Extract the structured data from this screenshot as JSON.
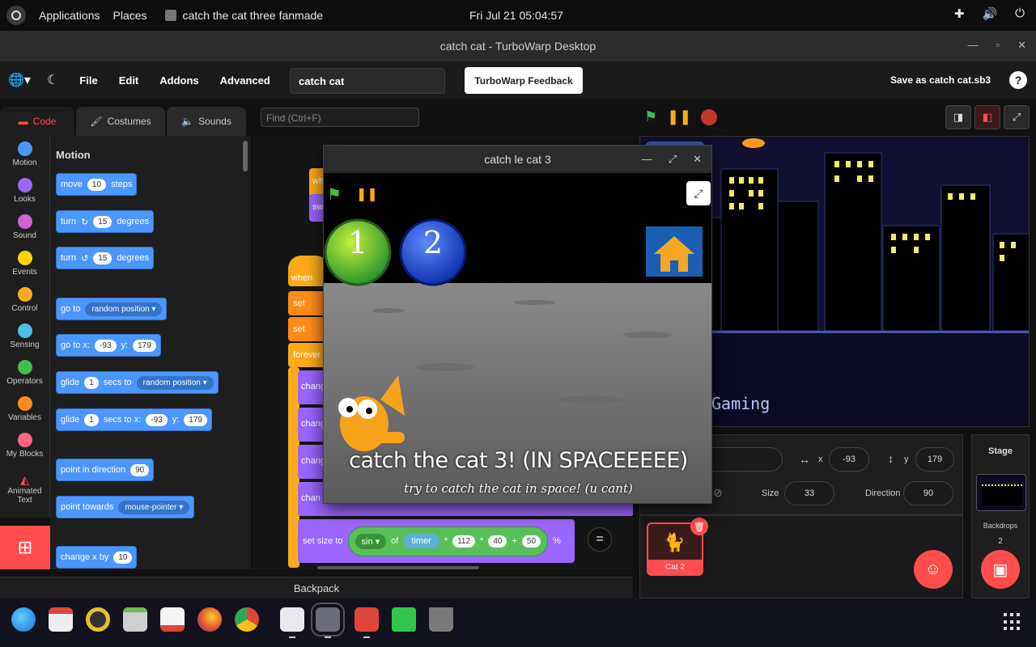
{
  "topbar": {
    "applications": "Applications",
    "places": "Places",
    "app_name": "catch the cat three fanmade",
    "clock": "Fri Jul 21  05:04:57",
    "tray_icons": [
      "puzzle-icon",
      "volume-icon",
      "power-icon"
    ]
  },
  "window": {
    "title": "catch cat - TurboWarp Desktop"
  },
  "menubar": {
    "items": [
      "File",
      "Edit",
      "Addons",
      "Advanced"
    ],
    "project_name": "catch cat",
    "feedback": "TurboWarp Feedback",
    "save": "Save as catch cat.sb3",
    "help": "?"
  },
  "tabs": {
    "code": "Code",
    "costumes": "Costumes",
    "sounds": "Sounds"
  },
  "find_placeholder": "Find (Ctrl+F)",
  "categories": [
    {
      "label": "Motion",
      "color": "#4c97ff"
    },
    {
      "label": "Looks",
      "color": "#9966ff"
    },
    {
      "label": "Sound",
      "color": "#cf63cf"
    },
    {
      "label": "Events",
      "color": "#ffd500"
    },
    {
      "label": "Control",
      "color": "#ffab19"
    },
    {
      "label": "Sensing",
      "color": "#4cbfe6"
    },
    {
      "label": "Operators",
      "color": "#40bf4a"
    },
    {
      "label": "Variables",
      "color": "#ff8c1a"
    },
    {
      "label": "My Blocks",
      "color": "#ff6680"
    },
    {
      "label": "Animated Text",
      "color": "#ff4c4c"
    }
  ],
  "palette": {
    "title": "Motion",
    "move": {
      "a": "move",
      "n": "10",
      "b": "steps"
    },
    "turn_right": {
      "a": "turn",
      "n": "15",
      "b": "degrees"
    },
    "turn_left": {
      "a": "turn",
      "n": "15",
      "b": "degrees"
    },
    "goto": {
      "a": "go to",
      "dd": "random position"
    },
    "gotoxy": {
      "a": "go to x:",
      "x": "-93",
      "b": "y:",
      "y": "179"
    },
    "glide": {
      "a": "glide",
      "n": "1",
      "b": "secs to",
      "dd": "random position"
    },
    "glidexy": {
      "a": "glide",
      "n": "1",
      "b": "secs to x:",
      "x": "-93",
      "c": "y:",
      "y": "179"
    },
    "point": {
      "a": "point in direction",
      "n": "90"
    },
    "towards": {
      "a": "point towards",
      "dd": "mouse-pointer"
    },
    "changex": {
      "a": "change x by",
      "n": "10"
    }
  },
  "workspace": {
    "fragments": [
      "wh",
      "sw",
      "when",
      "set",
      "set",
      "forever",
      "chang",
      "chang",
      "chang",
      "chan"
    ],
    "setsize": {
      "a": "set size to",
      "fn": "sin",
      "of": "of",
      "timer": "timer",
      "m1": "*",
      "v1": "112",
      "m2": "*",
      "v2": "40",
      "plus": "+",
      "v3": "50",
      "pct": "%"
    },
    "zoom_reset": "="
  },
  "backpack": "Backpack",
  "game": {
    "title": "catch le cat 3",
    "btn1": "1",
    "btn2": "2",
    "heading": "catch the cat 3! (IN SPACEEEEE)",
    "subheading": "try to catch the cat in space!  (u cant)"
  },
  "stage": {
    "text": "Gaming"
  },
  "sprite_info": {
    "x_label": "x",
    "x": "-93",
    "y_label": "y",
    "y": "179",
    "size_label": "Size",
    "size": "33",
    "direction_label": "Direction",
    "direction": "90"
  },
  "sprites": [
    {
      "name": "Cat 2"
    }
  ],
  "stage_pane": {
    "label": "Stage",
    "backdrops_label": "Backdrops",
    "backdrops": "2"
  },
  "dock": [
    "globe-icon",
    "calendar-icon",
    "music-icon",
    "files-icon",
    "store-icon",
    "firefox-icon",
    "chrome-icon",
    "settings-icon",
    "scratch-icon",
    "turbowarp-icon",
    "puzzle-icon",
    "trash-icon"
  ]
}
